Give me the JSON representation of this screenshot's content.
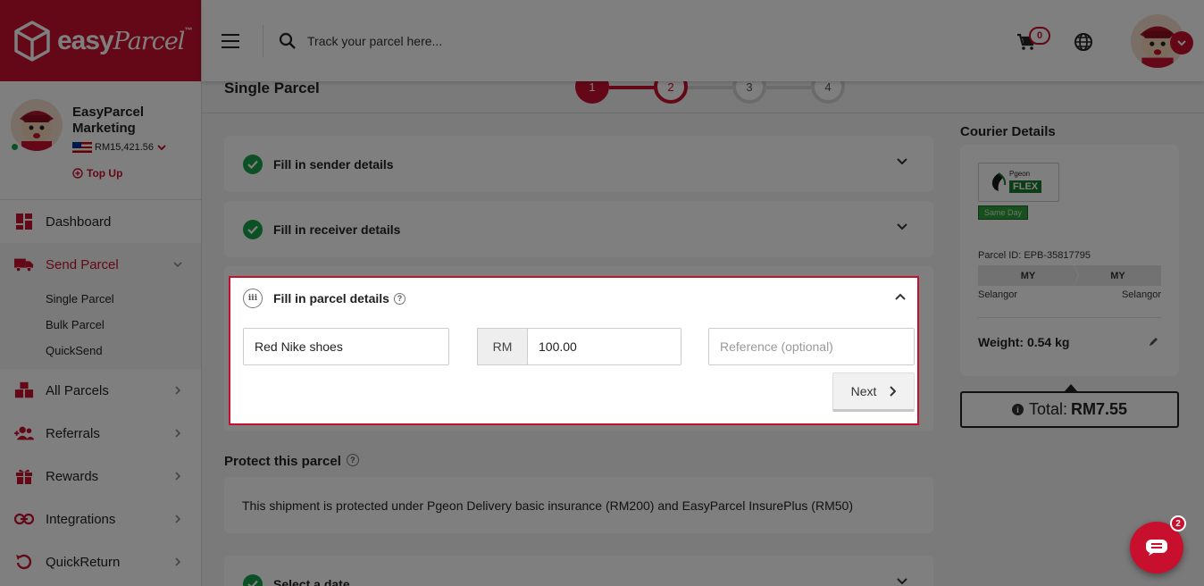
{
  "brand": {
    "name": "easy",
    "name_script": "Parcel",
    "tm": "™"
  },
  "profile": {
    "name": "EasyParcel Marketing",
    "balance": "RM15,421.56",
    "topup": "Top Up"
  },
  "nav": {
    "dashboard": "Dashboard",
    "send_parcel": "Send Parcel",
    "sub": {
      "single": "Single Parcel",
      "bulk": "Bulk Parcel",
      "quicksend": "QuickSend"
    },
    "all_parcels": "All Parcels",
    "referrals": "Referrals",
    "rewards": "Rewards",
    "integrations": "Integrations",
    "quickreturn": "QuickReturn"
  },
  "topbar": {
    "search_placeholder": "Track your parcel here...",
    "cart_count": "0"
  },
  "page": {
    "title": "Single Parcel",
    "steps": [
      "1",
      "2",
      "3",
      "4"
    ]
  },
  "sections": {
    "sender": "Fill in sender details",
    "receiver": "Fill in receiver details",
    "parcel": "Fill in parcel details",
    "parcel_num": "iii",
    "select_date": "Select a date"
  },
  "parcel_form": {
    "content_value": "Red Nike shoes",
    "currency": "RM",
    "value": "100.00",
    "reference_placeholder": "Reference (optional)",
    "next_label": "Next"
  },
  "protect": {
    "title": "Protect this parcel",
    "text": "This shipment is protected under Pgeon Delivery basic insurance (RM200) and EasyParcel InsurePlus (RM50)"
  },
  "courier": {
    "title": "Courier Details",
    "logo_text": "Pgeon",
    "logo_badge": "FLEX",
    "service": "Same Day",
    "parcel_id": "Parcel ID: EPB-35817795",
    "from_country": "MY",
    "to_country": "MY",
    "from_state": "Selangor",
    "to_state": "Selangor",
    "weight": "Weight: 0.54 kg",
    "total_label": "Total:",
    "total_value": "RM7.55"
  },
  "chat": {
    "badge": "2"
  },
  "colors": {
    "brand": "#c8102e",
    "success": "#19a34a"
  }
}
